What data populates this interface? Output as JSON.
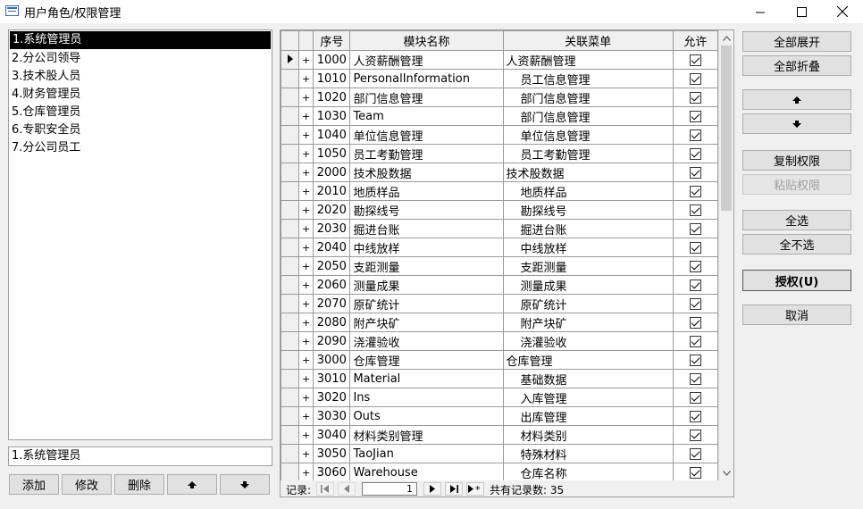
{
  "window": {
    "title": "用户角色/权限管理",
    "min_glyph": "—",
    "close_glyph": "✕"
  },
  "roles": {
    "items": [
      "1.系统管理员",
      "2.分公司领导",
      "3.技术股人员",
      "4.财务管理员",
      "5.仓库管理员",
      "6.专职安全员",
      "7.分公司员工"
    ],
    "selected_index": 0,
    "current_value": "1.系统管理员",
    "buttons": {
      "add": "添加",
      "edit": "修改",
      "delete": "删除"
    }
  },
  "grid": {
    "columns": {
      "seq": "序号",
      "module": "模块名称",
      "menu": "关联菜单",
      "allow": "允许"
    },
    "expander_glyph": "+",
    "rows": [
      {
        "seq": "1000",
        "module": "人资薪酬管理",
        "menu": "人资薪酬管理",
        "sub": false,
        "allow": true
      },
      {
        "seq": "1010",
        "module": "PersonalInformation",
        "menu": "员工信息管理",
        "sub": true,
        "allow": true
      },
      {
        "seq": "1020",
        "module": "部门信息管理",
        "menu": "部门信息管理",
        "sub": true,
        "allow": true
      },
      {
        "seq": "1030",
        "module": "Team",
        "menu": "部门信息管理",
        "sub": true,
        "allow": true
      },
      {
        "seq": "1040",
        "module": "单位信息管理",
        "menu": "单位信息管理",
        "sub": true,
        "allow": true
      },
      {
        "seq": "1050",
        "module": "员工考勤管理",
        "menu": "员工考勤管理",
        "sub": true,
        "allow": true
      },
      {
        "seq": "2000",
        "module": "技术股数据",
        "menu": "技术股数据",
        "sub": false,
        "allow": true
      },
      {
        "seq": "2010",
        "module": "地质样品",
        "menu": "地质样品",
        "sub": true,
        "allow": true
      },
      {
        "seq": "2020",
        "module": "勘探线号",
        "menu": "勘探线号",
        "sub": true,
        "allow": true
      },
      {
        "seq": "2030",
        "module": "掘进台账",
        "menu": "掘进台账",
        "sub": true,
        "allow": true
      },
      {
        "seq": "2040",
        "module": "中线放样",
        "menu": "中线放样",
        "sub": true,
        "allow": true
      },
      {
        "seq": "2050",
        "module": "支距测量",
        "menu": "支距测量",
        "sub": true,
        "allow": true
      },
      {
        "seq": "2060",
        "module": "测量成果",
        "menu": "测量成果",
        "sub": true,
        "allow": true
      },
      {
        "seq": "2070",
        "module": "原矿统计",
        "menu": "原矿统计",
        "sub": true,
        "allow": true
      },
      {
        "seq": "2080",
        "module": "附产块矿",
        "menu": "附产块矿",
        "sub": true,
        "allow": true
      },
      {
        "seq": "2090",
        "module": "浇灌验收",
        "menu": "浇灌验收",
        "sub": true,
        "allow": true
      },
      {
        "seq": "3000",
        "module": "仓库管理",
        "menu": "仓库管理",
        "sub": false,
        "allow": true
      },
      {
        "seq": "3010",
        "module": "Material",
        "menu": "基础数据",
        "sub": true,
        "allow": true
      },
      {
        "seq": "3020",
        "module": "Ins",
        "menu": "入库管理",
        "sub": true,
        "allow": true
      },
      {
        "seq": "3030",
        "module": "Outs",
        "menu": "出库管理",
        "sub": true,
        "allow": true
      },
      {
        "seq": "3040",
        "module": "材料类别管理",
        "menu": "材料类别",
        "sub": true,
        "allow": true
      },
      {
        "seq": "3050",
        "module": "TaoJian",
        "menu": "特殊材料",
        "sub": true,
        "allow": true
      },
      {
        "seq": "3060",
        "module": "Warehouse",
        "menu": "仓库名称",
        "sub": true,
        "allow": true
      }
    ],
    "current_row_index": 0
  },
  "navigator": {
    "label": "记录:",
    "current_record": "1",
    "total_text": "共有记录数: 35"
  },
  "actions": {
    "expand_all": "全部展开",
    "collapse_all": "全部折叠",
    "copy_rights": "复制权限",
    "paste_rights": "粘贴权限",
    "select_all": "全选",
    "select_none": "全不选",
    "authorize": "授权(U)",
    "cancel": "取消"
  }
}
